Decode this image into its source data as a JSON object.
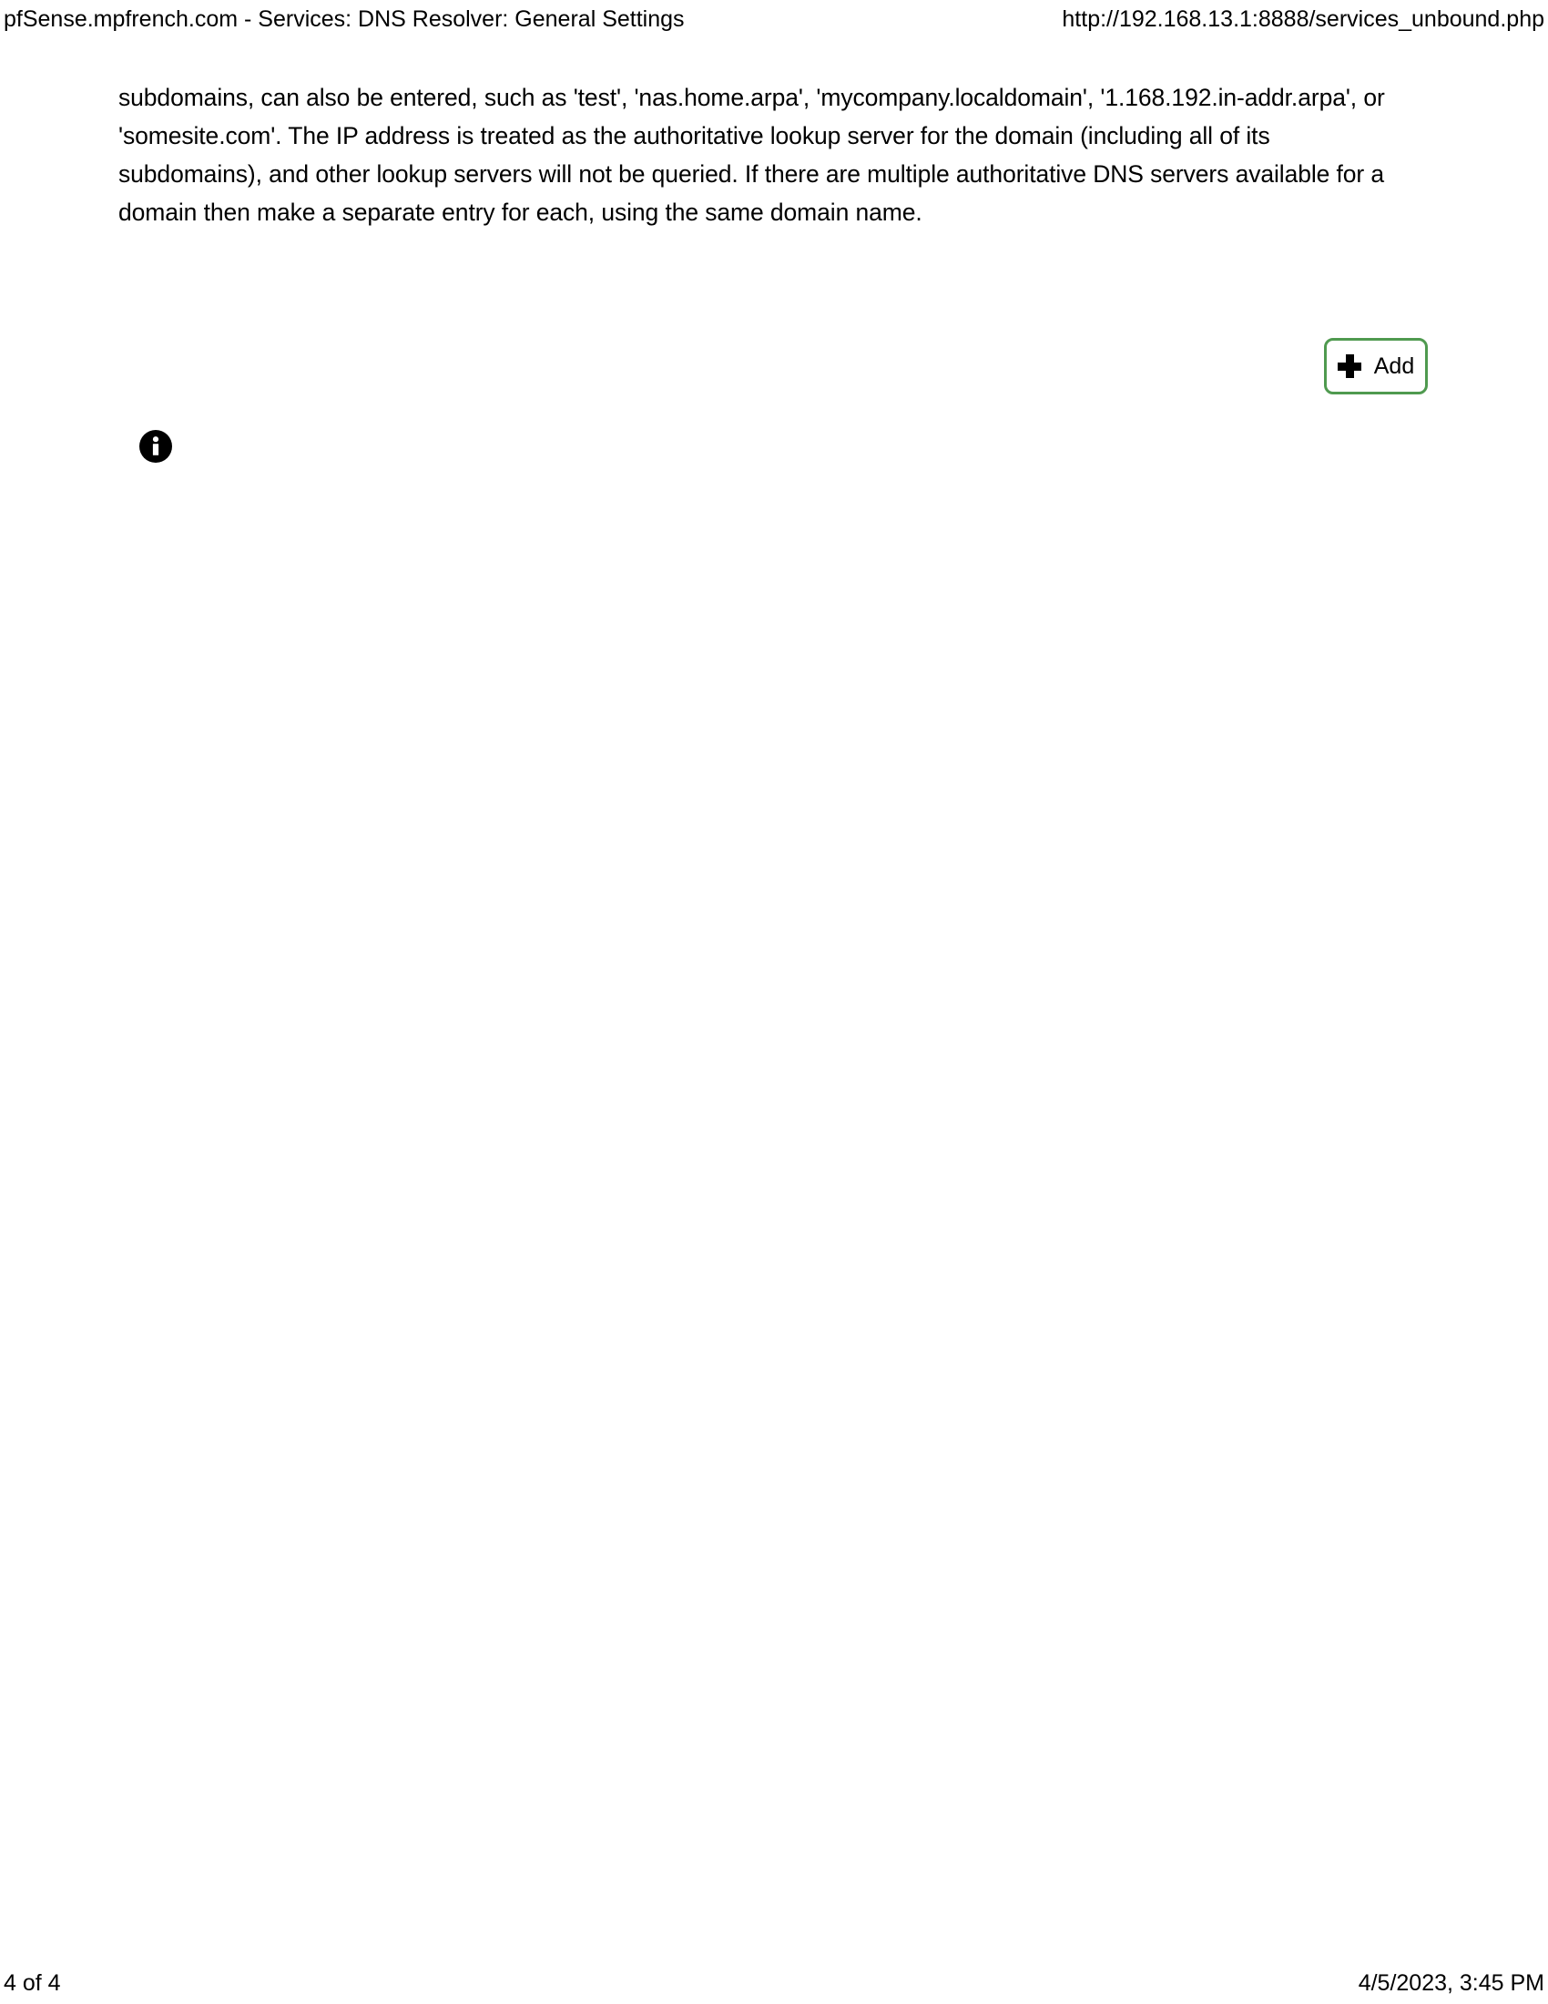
{
  "print_header": {
    "left_title": "pfSense.mpfrench.com - Services: DNS Resolver: General Settings",
    "right_url": "http://192.168.13.1:8888/services_unbound.php"
  },
  "main": {
    "help_text": "subdomains, can also be entered, such as 'test', 'nas.home.arpa', 'mycompany.localdomain', '1.168.192.in-addr.arpa', or 'somesite.com'. The IP address is treated as the authoritative lookup server for the domain (including all of its subdomains), and other lookup servers will not be queried. If there are multiple authoritative DNS servers available for a domain then make a separate entry for each, using the same domain name."
  },
  "toolbar": {
    "add_label": "Add",
    "add_icon": "plus-icon",
    "add_border_color": "#4f9a4f"
  },
  "info": {
    "icon": "info-circle-icon",
    "icon_color": "#000000"
  },
  "print_footer": {
    "page_indicator": "4 of 4",
    "timestamp": "4/5/2023, 3:45 PM"
  }
}
